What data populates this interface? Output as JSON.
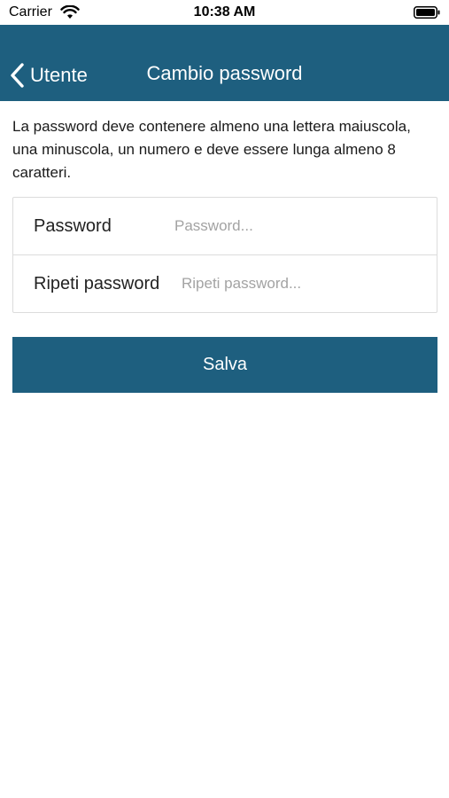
{
  "status_bar": {
    "carrier": "Carrier",
    "time": "10:38 AM",
    "wifi_icon": "wifi-icon",
    "battery_icon": "battery-icon"
  },
  "nav": {
    "back_label": "Utente",
    "title": "Cambio password",
    "background_color": "#1e5f7f"
  },
  "hint": "La password deve contenere almeno una lettera maiuscola, una minuscola, un numero e deve essere lunga almeno 8 caratteri.",
  "form": {
    "password": {
      "label": "Password",
      "value": "",
      "placeholder": "Password..."
    },
    "repeat_password": {
      "label": "Ripeti password",
      "value": "",
      "placeholder": "Ripeti password..."
    }
  },
  "save_button": {
    "label": "Salva",
    "color": "#1e5f7f"
  }
}
